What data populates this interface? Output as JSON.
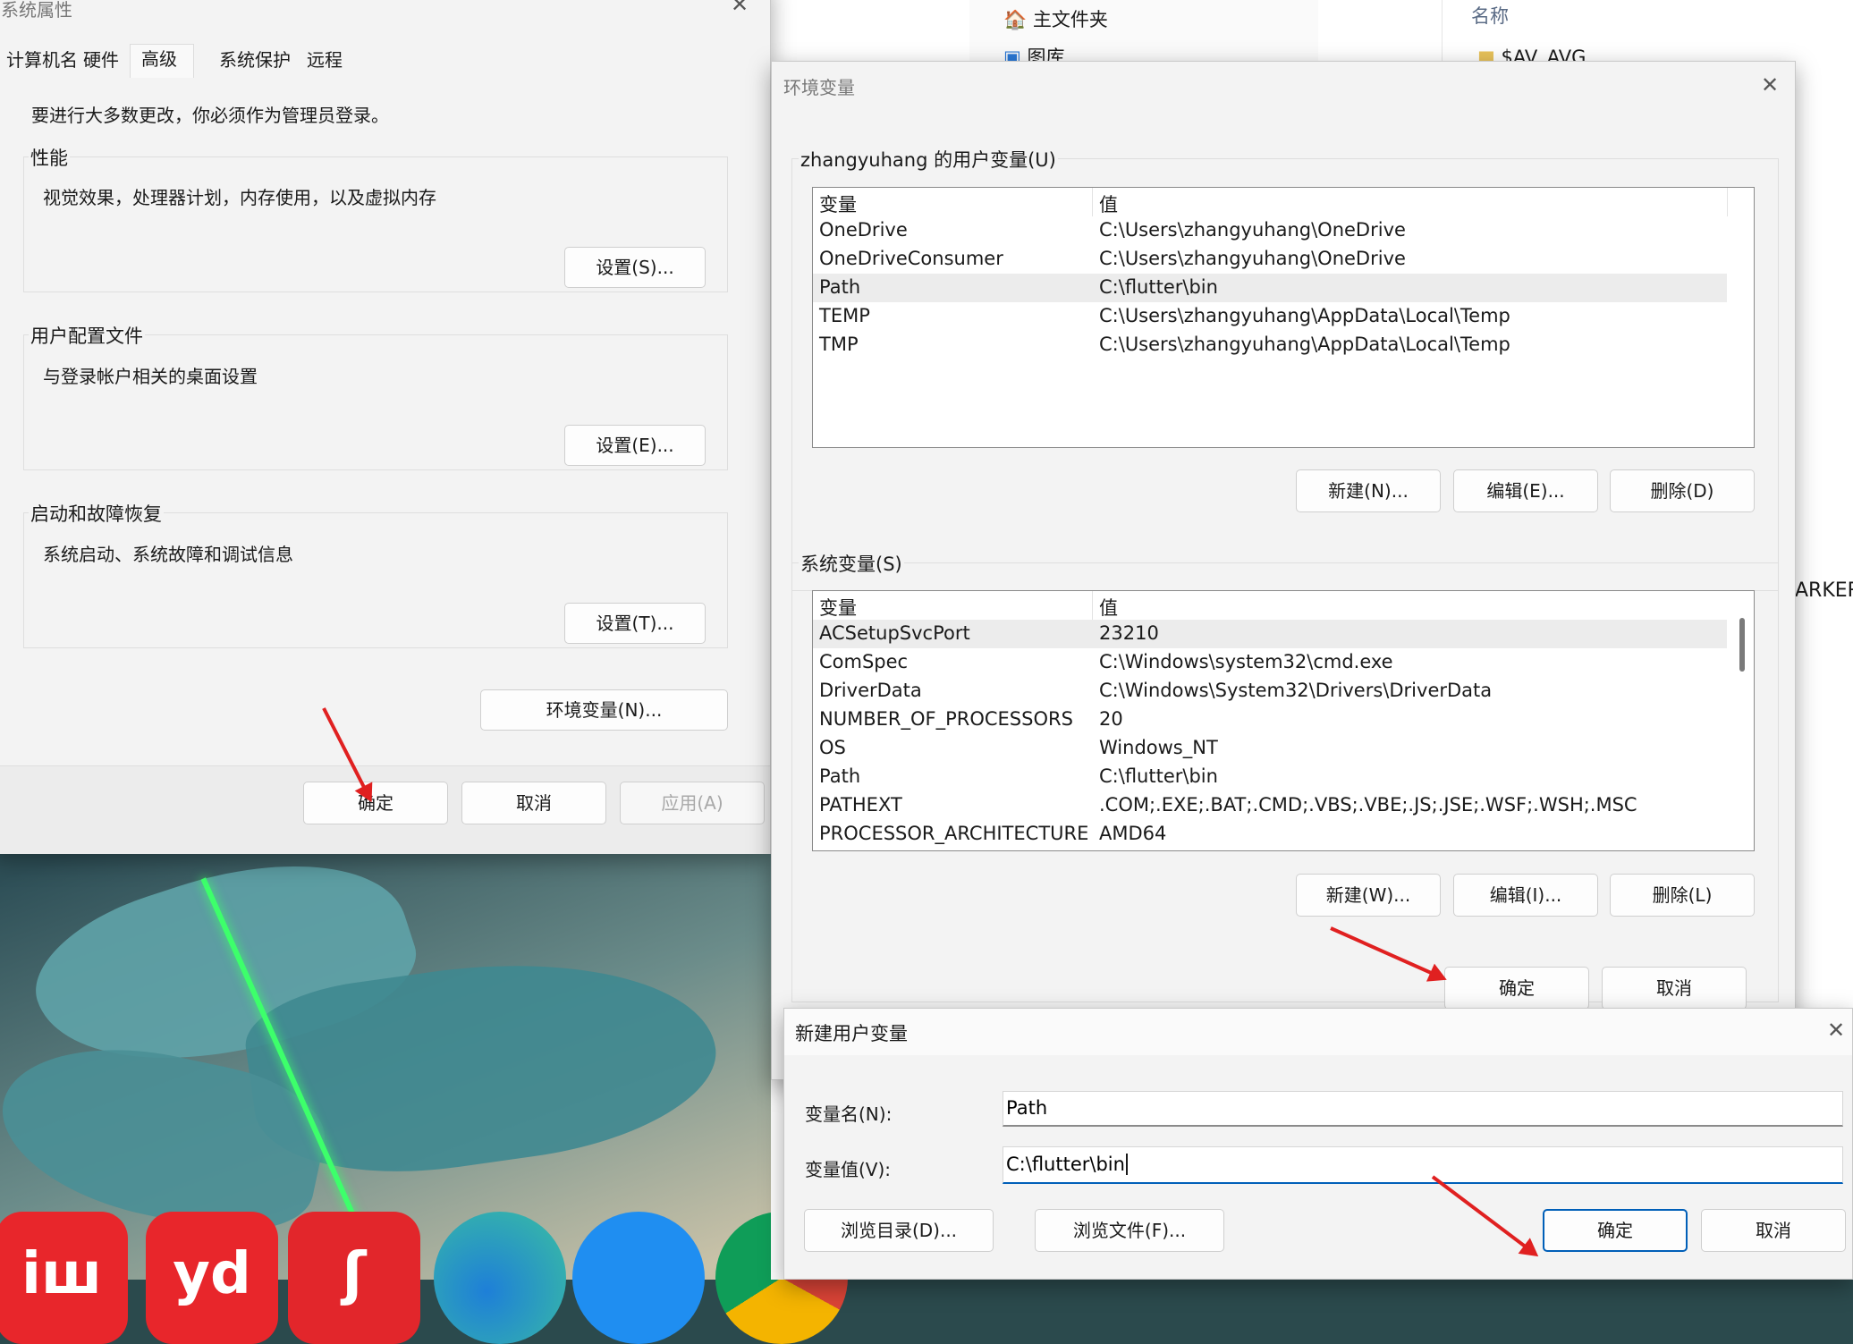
{
  "explorer": {
    "nav_items": [
      "主文件夹",
      "图库"
    ],
    "column_header": "名称",
    "file_name": "$AV_AVG",
    "partial_text": "ARKER"
  },
  "sysprops": {
    "title": "系统属性",
    "tabs": [
      "计算机名",
      "硬件",
      "高级",
      "系统保护",
      "远程"
    ],
    "active_tab": 2,
    "admin_note": "要进行大多数更改，你必须作为管理员登录。",
    "performance": {
      "label": "性能",
      "desc": "视觉效果，处理器计划，内存使用，以及虚拟内存",
      "button": "设置(S)..."
    },
    "profile": {
      "label": "用户配置文件",
      "desc": "与登录帐户相关的桌面设置",
      "button": "设置(E)..."
    },
    "startup": {
      "label": "启动和故障恢复",
      "desc": "系统启动、系统故障和调试信息",
      "button": "设置(T)..."
    },
    "env_button": "环境变量(N)...",
    "ok": "确定",
    "cancel": "取消",
    "apply": "应用(A)"
  },
  "envvars": {
    "title": "环境变量",
    "user_group": "zhangyuhang 的用户变量(U)",
    "system_group": "系统变量(S)",
    "col_var": "变量",
    "col_val": "值",
    "user_vars": [
      {
        "name": "OneDrive",
        "value": "C:\\Users\\zhangyuhang\\OneDrive"
      },
      {
        "name": "OneDriveConsumer",
        "value": "C:\\Users\\zhangyuhang\\OneDrive"
      },
      {
        "name": "Path",
        "value": "C:\\flutter\\bin"
      },
      {
        "name": "TEMP",
        "value": "C:\\Users\\zhangyuhang\\AppData\\Local\\Temp"
      },
      {
        "name": "TMP",
        "value": "C:\\Users\\zhangyuhang\\AppData\\Local\\Temp"
      }
    ],
    "user_selected": 2,
    "system_vars": [
      {
        "name": "ACSetupSvcPort",
        "value": "23210"
      },
      {
        "name": "ComSpec",
        "value": "C:\\Windows\\system32\\cmd.exe"
      },
      {
        "name": "DriverData",
        "value": "C:\\Windows\\System32\\Drivers\\DriverData"
      },
      {
        "name": "NUMBER_OF_PROCESSORS",
        "value": "20"
      },
      {
        "name": "OS",
        "value": "Windows_NT"
      },
      {
        "name": "Path",
        "value": "C:\\flutter\\bin"
      },
      {
        "name": "PATHEXT",
        "value": ".COM;.EXE;.BAT;.CMD;.VBS;.VBE;.JS;.JSE;.WSF;.WSH;.MSC"
      },
      {
        "name": "PROCESSOR_ARCHITECTURE",
        "value": "AMD64"
      }
    ],
    "system_selected": 0,
    "user_buttons": {
      "new": "新建(N)...",
      "edit": "编辑(E)...",
      "delete": "删除(D)"
    },
    "system_buttons": {
      "new": "新建(W)...",
      "edit": "编辑(I)...",
      "delete": "删除(L)"
    },
    "ok": "确定",
    "cancel": "取消"
  },
  "newvar": {
    "title": "新建用户变量",
    "name_label": "变量名(N):",
    "name_value": "Path",
    "value_label": "变量值(V):",
    "value_value": "C:\\flutter\\bin",
    "browse_dir": "浏览目录(D)...",
    "browse_file": "浏览文件(F)...",
    "ok": "确定",
    "cancel": "取消"
  },
  "dock": {
    "icons": [
      "video-app-icon",
      "youdao-icon",
      "netease-music-icon",
      "edge-icon",
      "browser-icon",
      "chrome-icon"
    ],
    "labels": [
      "iш",
      "yd",
      "ʃ"
    ]
  },
  "colors": {
    "accent": "#005fb8",
    "annotation_arrow": "#e02020",
    "window_bg": "#f3f3f3",
    "selected_row": "#ececec"
  }
}
